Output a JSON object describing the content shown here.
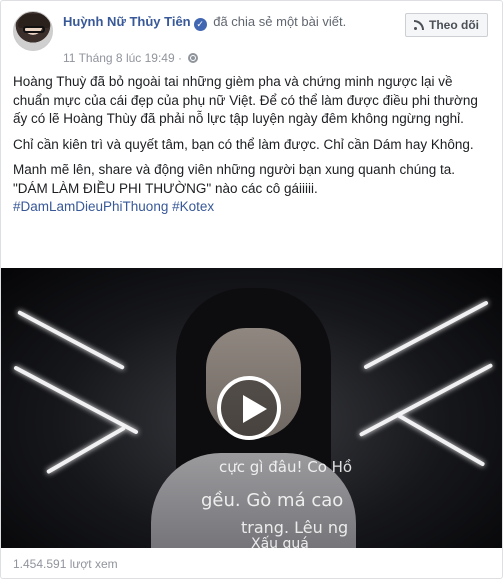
{
  "post": {
    "author_name": "Huỳnh Nữ Thủy Tiên",
    "verified_mark": "✓",
    "action_text": " đã chia sẻ một bài viết.",
    "timestamp": "11 Tháng 8 lúc 19:49",
    "follow_button_label": "Theo dõi",
    "paragraphs": [
      "Hoàng Thuỳ đã bỏ ngoài tai những gièm pha và chứng minh ngược lại về chuẩn mực của cái đẹp của phụ nữ Việt. Để có thể làm được điều phi thường ấy có lẽ Hoàng Thùy đã phải nỗ lực tập luyện ngày đêm không ngừng nghỉ.",
      "Chỉ cần kiên trì và quyết tâm, bạn có thể làm được. Chỉ cần Dám hay Không.",
      "Manh mẽ lên, share và động viên những người bạn xung quanh chúng ta. \"DÁM LÀM ĐIỀU PHI THƯỜNG\" nào các cô gáiiiii."
    ],
    "hashtags": "#DamLamDieuPhiThuong #Kotex",
    "video": {
      "projected_text": [
        "cực gì đâu! Co Hồ",
        "gều. Gò má cao",
        "trang. Lêu ng",
        "Xấu quá"
      ]
    },
    "view_count": "1.454.591 lượt xem"
  },
  "icons": {
    "follow": "rss-icon",
    "privacy": "globe-icon",
    "verified": "verified-badge-icon",
    "video_play": "play-icon"
  },
  "colors": {
    "link_blue": "#385898",
    "verified_blue": "#4267b2",
    "meta_gray": "#90949c"
  }
}
